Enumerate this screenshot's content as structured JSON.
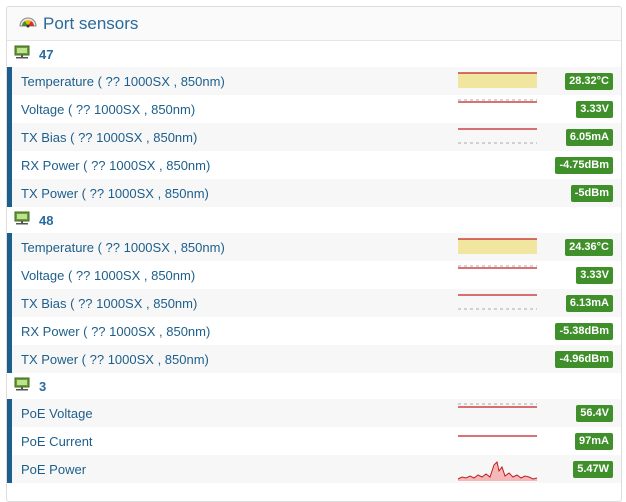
{
  "panel": {
    "title": "Port sensors"
  },
  "groups": [
    {
      "name": "47",
      "sensors": [
        {
          "label": "Temperature ( ?? 1000SX , 850nm)",
          "value": "28.32°C",
          "spark": "band"
        },
        {
          "label": "Voltage ( ?? 1000SX , 850nm)",
          "value": "3.33V",
          "spark": "line-dash"
        },
        {
          "label": "TX Bias ( ?? 1000SX , 850nm)",
          "value": "6.05mA",
          "spark": "line-dash-low"
        },
        {
          "label": "RX Power ( ?? 1000SX , 850nm)",
          "value": "-4.75dBm",
          "spark": "none"
        },
        {
          "label": "TX Power ( ?? 1000SX , 850nm)",
          "value": "-5dBm",
          "spark": "none"
        }
      ]
    },
    {
      "name": "48",
      "sensors": [
        {
          "label": "Temperature ( ?? 1000SX , 850nm)",
          "value": "24.36°C",
          "spark": "band"
        },
        {
          "label": "Voltage ( ?? 1000SX , 850nm)",
          "value": "3.33V",
          "spark": "line-dash"
        },
        {
          "label": "TX Bias ( ?? 1000SX , 850nm)",
          "value": "6.13mA",
          "spark": "line-dash-low"
        },
        {
          "label": "RX Power ( ?? 1000SX , 850nm)",
          "value": "-5.38dBm",
          "spark": "none"
        },
        {
          "label": "TX Power ( ?? 1000SX , 850nm)",
          "value": "-4.96dBm",
          "spark": "none"
        }
      ]
    },
    {
      "name": "3",
      "sensors": [
        {
          "label": "PoE Voltage",
          "value": "56.4V",
          "spark": "dash-line"
        },
        {
          "label": "PoE Current",
          "value": "97mA",
          "spark": "line"
        },
        {
          "label": "PoE Power",
          "value": "5.47W",
          "spark": "area"
        }
      ]
    }
  ],
  "colors": {
    "accent": "#1d5f8c",
    "badge": "#3f8f2a",
    "spark_line": "#c21f1f",
    "spark_band": "#f0e6a0"
  },
  "icons": {
    "header": "dashboard-gauge-icon",
    "group": "network-port-icon"
  }
}
